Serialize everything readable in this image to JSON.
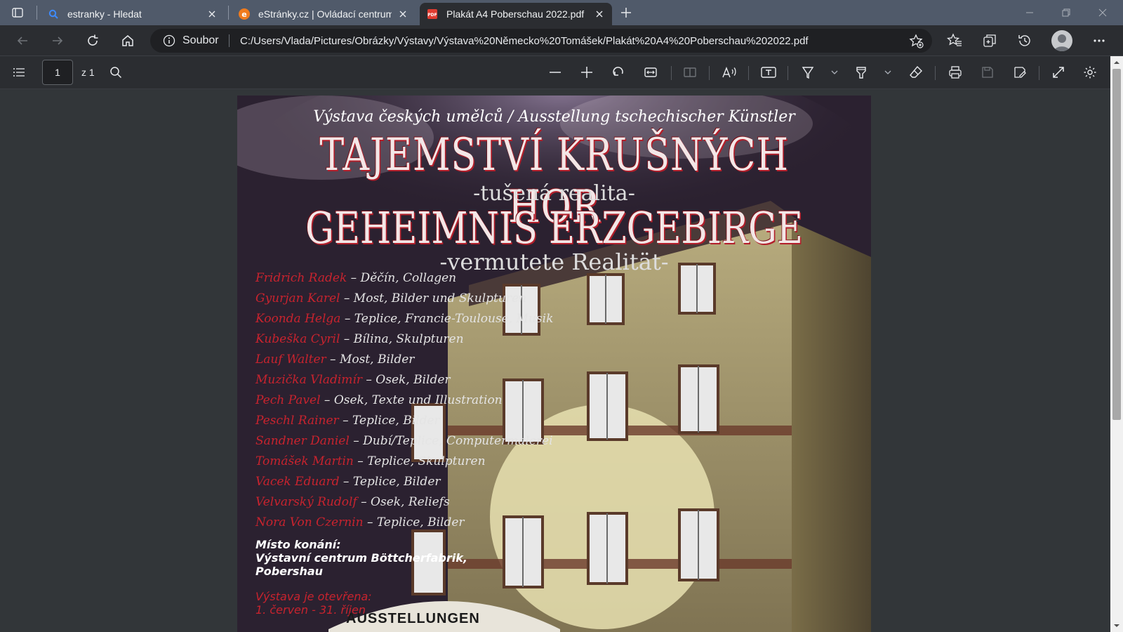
{
  "tabs": [
    {
      "title": "estranky - Hledat",
      "icon": "search-icon"
    },
    {
      "title": "eStránky.cz | Ovládací centrum u",
      "icon": "estranky-favicon"
    },
    {
      "title": "Plakát A4 Poberschau 2022.pdf",
      "icon": "pdf-icon",
      "active": true
    }
  ],
  "address": {
    "protocol_label": "Soubor",
    "url": "C:/Users/Vlada/Pictures/Obrázky/Výstavy/Výstava%20Německo%20Tomášek/Plakát%20A4%20Poberschau%202022.pdf"
  },
  "pdf_toolbar": {
    "page_number": "1",
    "page_of": "z 1"
  },
  "poster": {
    "subtitle": "Výstava českých umělců / Ausstellung tschechischer Künstler",
    "title_cz": "TAJEMSTVÍ KRUŠNÝCH HOR",
    "tagline_cz": "-tušená realita-",
    "title_de": "GEHEIMNIS ERZGEBIRGE",
    "tagline_de": "-vermutete Realität-",
    "artists": [
      {
        "name": "Fridrich Radek",
        "desc": " – Děčín, Collagen"
      },
      {
        "name": "Gyurjan Karel",
        "desc": " – Most, Bilder und Skulpturen"
      },
      {
        "name": "Koonda Helga",
        "desc": " – Teplice, Francie-Toulouse, Musik"
      },
      {
        "name": "Kubeška Cyril",
        "desc": " – Bílina, Skulpturen"
      },
      {
        "name": "Lauf Walter",
        "desc": " – Most, Bilder"
      },
      {
        "name": "Muzička Vladimír",
        "desc": " – Osek, Bilder"
      },
      {
        "name": "Pech Pavel",
        "desc": " – Osek, Texte und Illustration"
      },
      {
        "name": "Peschl Rainer",
        "desc": " – Teplice, Bilder"
      },
      {
        "name": "Sandner Daniel",
        "desc": " – Dubí/Teplice, Computermalerei"
      },
      {
        "name": "Tomášek Martin",
        "desc": " – Teplice, Skulpturen"
      },
      {
        "name": "Vacek Eduard",
        "desc": " – Teplice, Bilder"
      },
      {
        "name": "Velvarský Rudolf",
        "desc": " – Osek, Reliefs"
      },
      {
        "name": "Nora Von Czernin",
        "desc": " – Teplice, Bilder"
      }
    ],
    "venue_label": "Místo konání:",
    "venue_name": "Výstavní centrum Böttcherfabrik,",
    "venue_city": "Pobershau",
    "open_label": "Výstava je otevřena:",
    "open_dates": "1. červen - 31. říjen",
    "sign_text": "AUSSTELLUNGEN"
  },
  "colors": {
    "tabstrip": "#505a6a",
    "toolbar": "#2b2d31",
    "viewer_bg": "#323639",
    "poster_red": "#c8232e"
  }
}
